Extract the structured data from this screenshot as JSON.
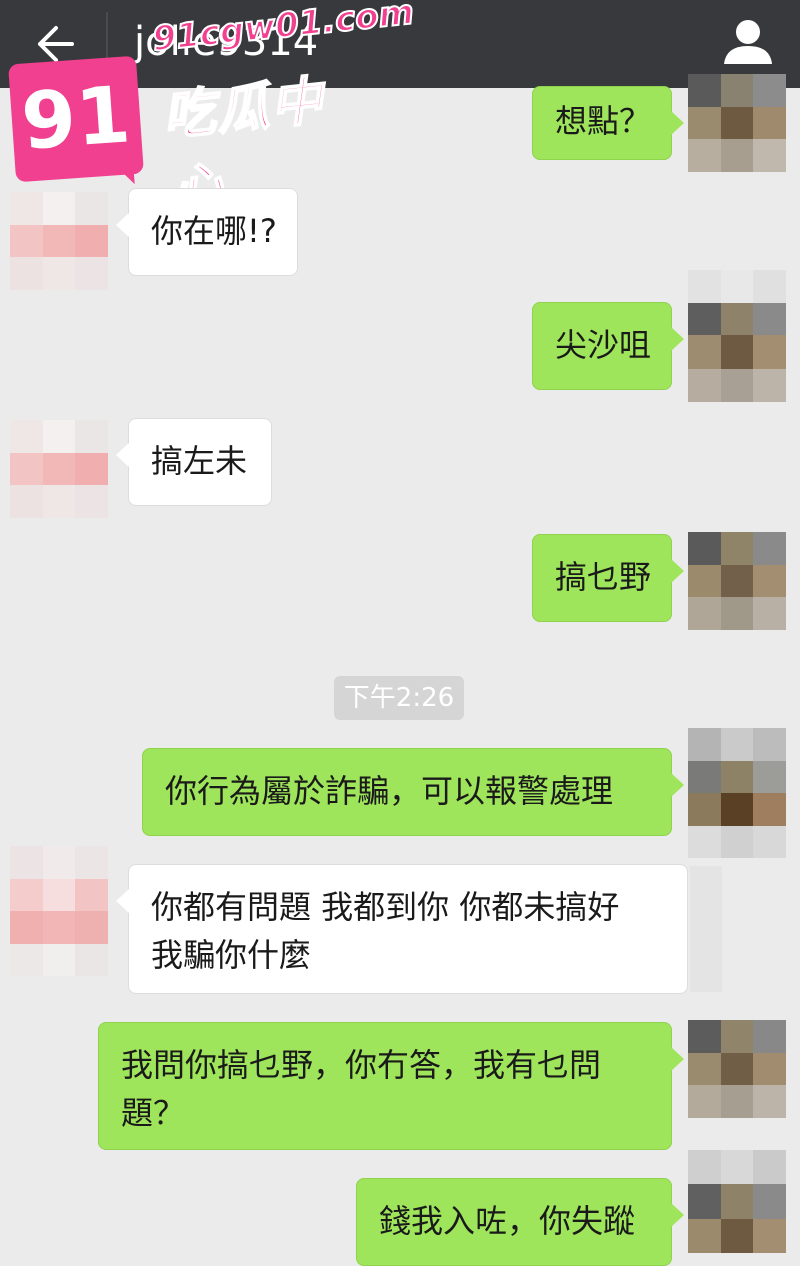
{
  "header": {
    "title": "jolie9314",
    "back_icon": "arrow-left-icon",
    "profile_icon": "person-icon"
  },
  "watermark": {
    "badge": "91",
    "url": "91cgw01.com",
    "text": "吃瓜中心"
  },
  "messages": [
    {
      "from": "me",
      "text": "想點？"
    },
    {
      "from": "other",
      "text": "你在哪!?"
    },
    {
      "from": "me",
      "text": "尖沙咀"
    },
    {
      "from": "other",
      "text": "搞左未"
    },
    {
      "from": "me",
      "text": "搞乜野"
    },
    {
      "from": "me",
      "text": "你行為屬於詐騙，可以報警處理"
    },
    {
      "from": "other",
      "text": "你都有問題 我都到你 你都未搞好\n我騙你什麼"
    },
    {
      "from": "me",
      "text": "我問你搞乜野，你冇答，我有乜問\n題？"
    },
    {
      "from": "me",
      "text": "錢我入咗，你失蹤"
    }
  ],
  "timestamp": "下午2:26",
  "colors": {
    "header_bg": "#38393c",
    "chat_bg": "#ebebeb",
    "outgoing_bubble": "#9ee55b",
    "incoming_bubble": "#ffffff",
    "watermark": "#f0408f"
  }
}
